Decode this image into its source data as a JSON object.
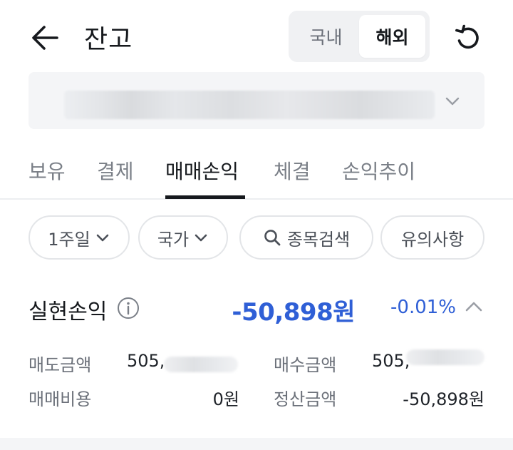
{
  "header": {
    "title": "잔고",
    "segment": [
      "국내",
      "해외"
    ],
    "segment_active": "해외"
  },
  "account": {
    "masked": true
  },
  "tabs": [
    {
      "label": "보유"
    },
    {
      "label": "결제"
    },
    {
      "label": "매매손익"
    },
    {
      "label": "체결"
    },
    {
      "label": "손익추이"
    }
  ],
  "active_tab": "매매손익",
  "filters": {
    "period": "1주일",
    "country": "국가",
    "search": "종목검색",
    "notice": "유의사항"
  },
  "summary": {
    "label": "실현손익",
    "value": "-50,898원",
    "rate": "-0.01%"
  },
  "details": {
    "sell_amount_label": "매도금액",
    "sell_amount_value": "505,",
    "fees_label": "매매비용",
    "fees_value": "0원",
    "buy_amount_label": "매수금액",
    "buy_amount_value": "505,",
    "settlement_label": "정산금액",
    "settlement_value": "-50,898원"
  },
  "colors": {
    "accent_blue": "#2f5fd6",
    "text_primary": "#16191d",
    "text_secondary": "#6b7079"
  },
  "icons": [
    "back-arrow-icon",
    "refresh-icon",
    "chevron-down-icon",
    "search-icon",
    "info-icon",
    "chevron-up-icon"
  ]
}
